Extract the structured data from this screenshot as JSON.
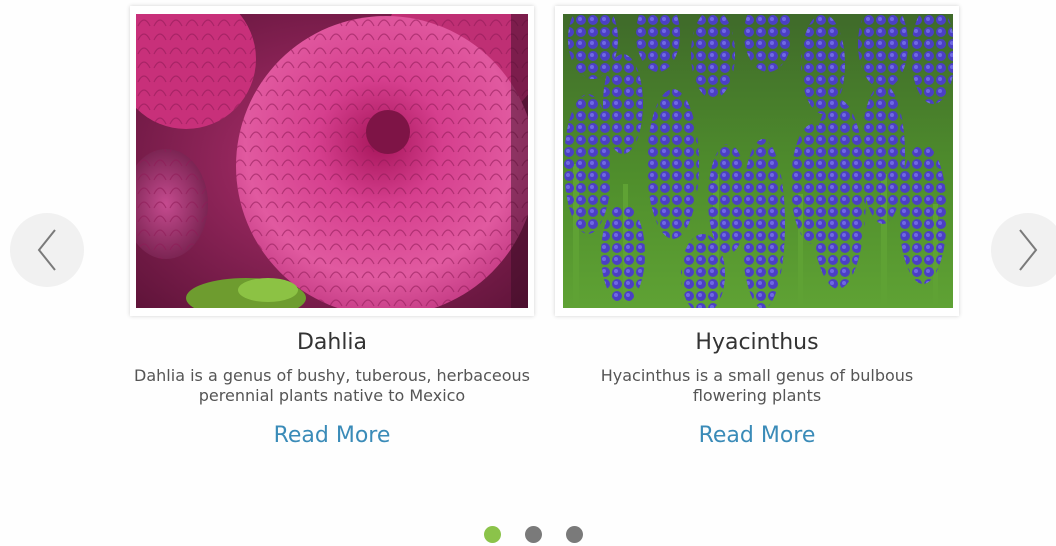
{
  "carousel": {
    "prev_icon": "chevron-left-icon",
    "next_icon": "chevron-right-icon",
    "accent_color": "#8bc34a",
    "link_color": "#3a8bb8",
    "slides": [
      {
        "title": "Dahlia",
        "description": "Dahlia is a genus of bushy, tuberous, herbaceous perennial plants native to Mexico",
        "link_label": "Read More"
      },
      {
        "title": "Hyacinthus",
        "description": "Hyacinthus is a small genus of bulbous flowering plants",
        "link_label": "Read More"
      }
    ],
    "pagination": {
      "total": 3,
      "active_index": 0
    }
  }
}
